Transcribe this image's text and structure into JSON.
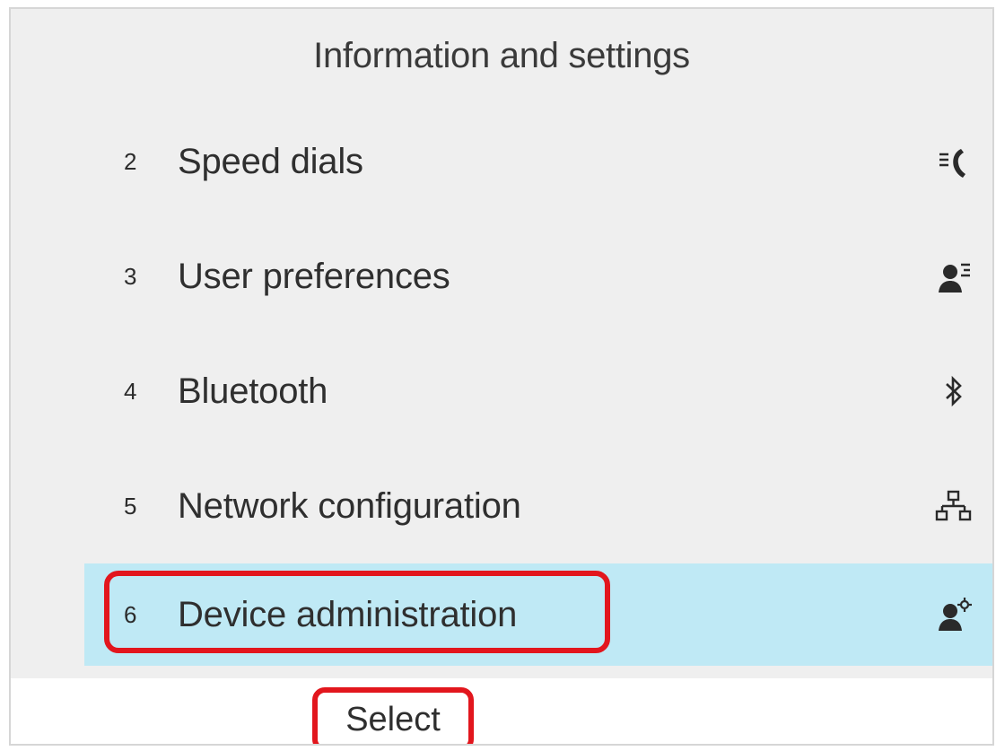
{
  "header": {
    "title": "Information and settings"
  },
  "menu": {
    "items": [
      {
        "number": "2",
        "label": "Speed dials",
        "icon": "speed-dial-icon",
        "selected": false
      },
      {
        "number": "3",
        "label": "User preferences",
        "icon": "user-preferences-icon",
        "selected": false
      },
      {
        "number": "4",
        "label": "Bluetooth",
        "icon": "bluetooth-icon",
        "selected": false
      },
      {
        "number": "5",
        "label": "Network configuration",
        "icon": "network-icon",
        "selected": false
      },
      {
        "number": "6",
        "label": "Device administration",
        "icon": "device-admin-icon",
        "selected": true
      }
    ]
  },
  "softkeys": {
    "select_label": "Select"
  },
  "colors": {
    "selected_row": "#bfe9f5",
    "annotation_red": "#e2161d",
    "screen_bg": "#efefef"
  }
}
